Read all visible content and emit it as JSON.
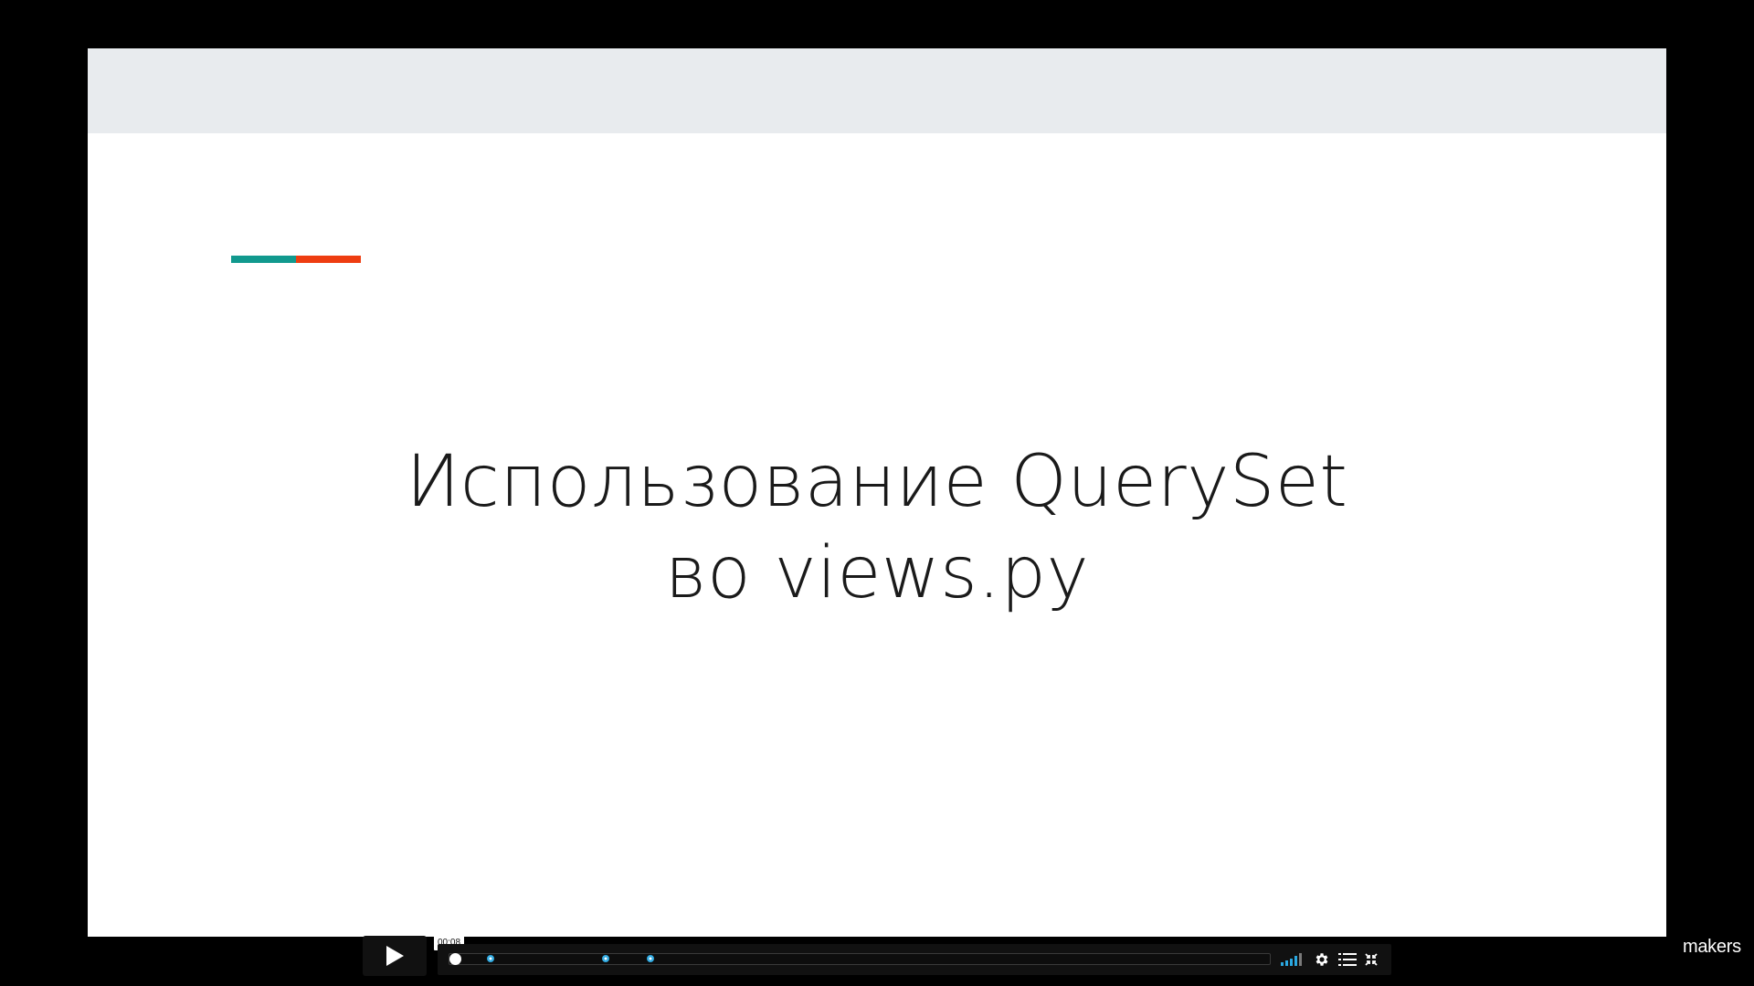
{
  "slide": {
    "title_line1": "Использование QuerySet",
    "title_line2": "во views.py",
    "accent_colors": [
      "#11998e",
      "#ee3d11"
    ]
  },
  "player": {
    "current_time": "00:08",
    "progress": 0.0,
    "chapter_markers": [
      0.05,
      0.19,
      0.245
    ],
    "volume_level": 0.8,
    "accent_color": "#2aa7e0"
  },
  "brand": {
    "logo_text": "makers"
  },
  "icons": {
    "play": "play-icon",
    "volume": "volume-bars-icon",
    "settings": "gear-icon",
    "chapters": "list-icon",
    "fullscreen": "fullscreen-exit-icon"
  }
}
